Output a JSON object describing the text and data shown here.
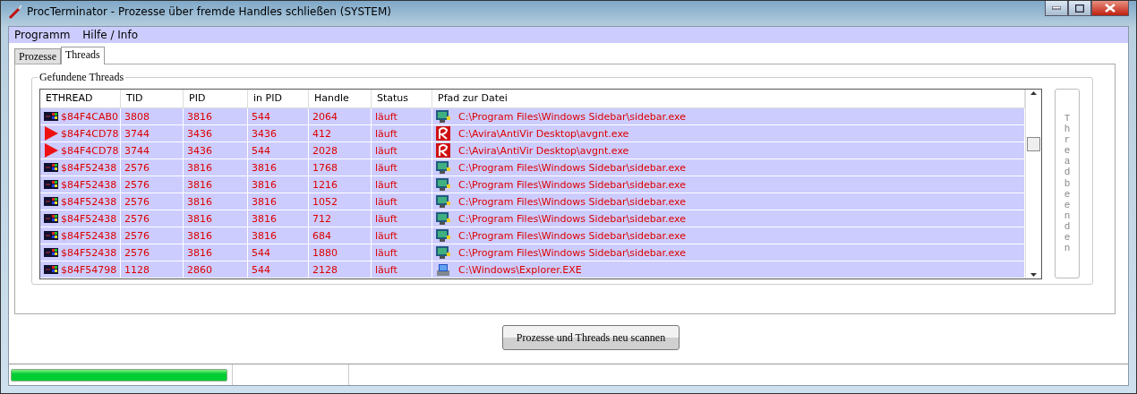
{
  "window": {
    "title": "ProcTerminator - Prozesse über fremde Handles schließen  (SYSTEM)"
  },
  "menu": [
    "Programm",
    "Hilfe / Info"
  ],
  "tabs": [
    {
      "label": "Prozesse",
      "selected": false
    },
    {
      "label": "Threads",
      "selected": true
    }
  ],
  "group": {
    "title": "Gefundene Threads"
  },
  "table": {
    "columns": [
      "ETHREAD",
      "TID",
      "PID",
      "in PID",
      "Handle",
      "Status",
      "Pfad zur Datei"
    ],
    "rows": [
      {
        "cells": [
          {
            "kind": "chip",
            "text": "$84F4CAB0"
          },
          "3808",
          "3816",
          "544",
          "2064",
          "läuft",
          {
            "kind": "monitor",
            "text": "C:\\Program Files\\Windows Sidebar\\sidebar.exe"
          }
        ]
      },
      {
        "cells": [
          {
            "kind": "triangle",
            "text": "$84F4CD78"
          },
          "3744",
          "3436",
          "3436",
          "412",
          "läuft",
          {
            "kind": "avira",
            "text": "C:\\Avira\\AntiVir Desktop\\avgnt.exe"
          }
        ]
      },
      {
        "cells": [
          {
            "kind": "triangle",
            "text": "$84F4CD78"
          },
          "3744",
          "3436",
          "544",
          "2028",
          "läuft",
          {
            "kind": "avira",
            "text": "C:\\Avira\\AntiVir Desktop\\avgnt.exe"
          }
        ]
      },
      {
        "cells": [
          {
            "kind": "chip",
            "text": "$84F52438"
          },
          "2576",
          "3816",
          "3816",
          "1768",
          "läuft",
          {
            "kind": "monitor",
            "text": "C:\\Program Files\\Windows Sidebar\\sidebar.exe"
          }
        ]
      },
      {
        "cells": [
          {
            "kind": "chip",
            "text": "$84F52438"
          },
          "2576",
          "3816",
          "3816",
          "1216",
          "läuft",
          {
            "kind": "monitor",
            "text": "C:\\Program Files\\Windows Sidebar\\sidebar.exe"
          }
        ]
      },
      {
        "cells": [
          {
            "kind": "chip",
            "text": "$84F52438"
          },
          "2576",
          "3816",
          "3816",
          "1052",
          "läuft",
          {
            "kind": "monitor",
            "text": "C:\\Program Files\\Windows Sidebar\\sidebar.exe"
          }
        ]
      },
      {
        "cells": [
          {
            "kind": "chip",
            "text": "$84F52438"
          },
          "2576",
          "3816",
          "3816",
          "712",
          "läuft",
          {
            "kind": "monitor",
            "text": "C:\\Program Files\\Windows Sidebar\\sidebar.exe"
          }
        ]
      },
      {
        "cells": [
          {
            "kind": "chip",
            "text": "$84F52438"
          },
          "2576",
          "3816",
          "3816",
          "684",
          "läuft",
          {
            "kind": "monitor",
            "text": "C:\\Program Files\\Windows Sidebar\\sidebar.exe"
          }
        ]
      },
      {
        "cells": [
          {
            "kind": "chip",
            "text": "$84F52438"
          },
          "2576",
          "3816",
          "544",
          "1880",
          "läuft",
          {
            "kind": "monitor",
            "text": "C:\\Program Files\\Windows Sidebar\\sidebar.exe"
          }
        ]
      },
      {
        "cells": [
          {
            "kind": "chip",
            "text": "$84F54798"
          },
          "1128",
          "2860",
          "544",
          "2128",
          "läuft",
          {
            "kind": "explorer",
            "text": "C:\\Windows\\Explorer.EXE"
          }
        ]
      }
    ]
  },
  "end_thread_button": {
    "label": "Thread beenden",
    "disabled": true
  },
  "rescan_button": {
    "label": "Prozesse und Threads neu scannen"
  },
  "status_bar": {
    "progress": {
      "level": 1.0
    }
  }
}
